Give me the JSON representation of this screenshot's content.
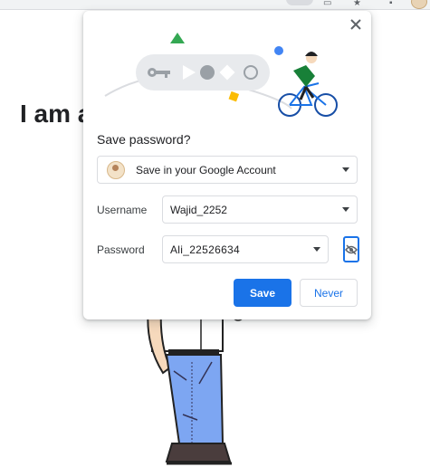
{
  "browser": {
    "icons": [
      "extensions-icon",
      "reading-list-icon",
      "bookmark-star-icon",
      "profile-icon"
    ]
  },
  "page": {
    "heading": "I am a"
  },
  "popup": {
    "title": "Save password?",
    "account": {
      "label": "Save in your Google Account",
      "selected": true
    },
    "username": {
      "label": "Username",
      "value": "Wajid_2252"
    },
    "password": {
      "label": "Password",
      "value": "Ali_22526634",
      "revealed": true
    },
    "buttons": {
      "save": "Save",
      "never": "Never"
    },
    "colors": {
      "accent": "#1a73e8",
      "border": "#dadce0"
    }
  }
}
